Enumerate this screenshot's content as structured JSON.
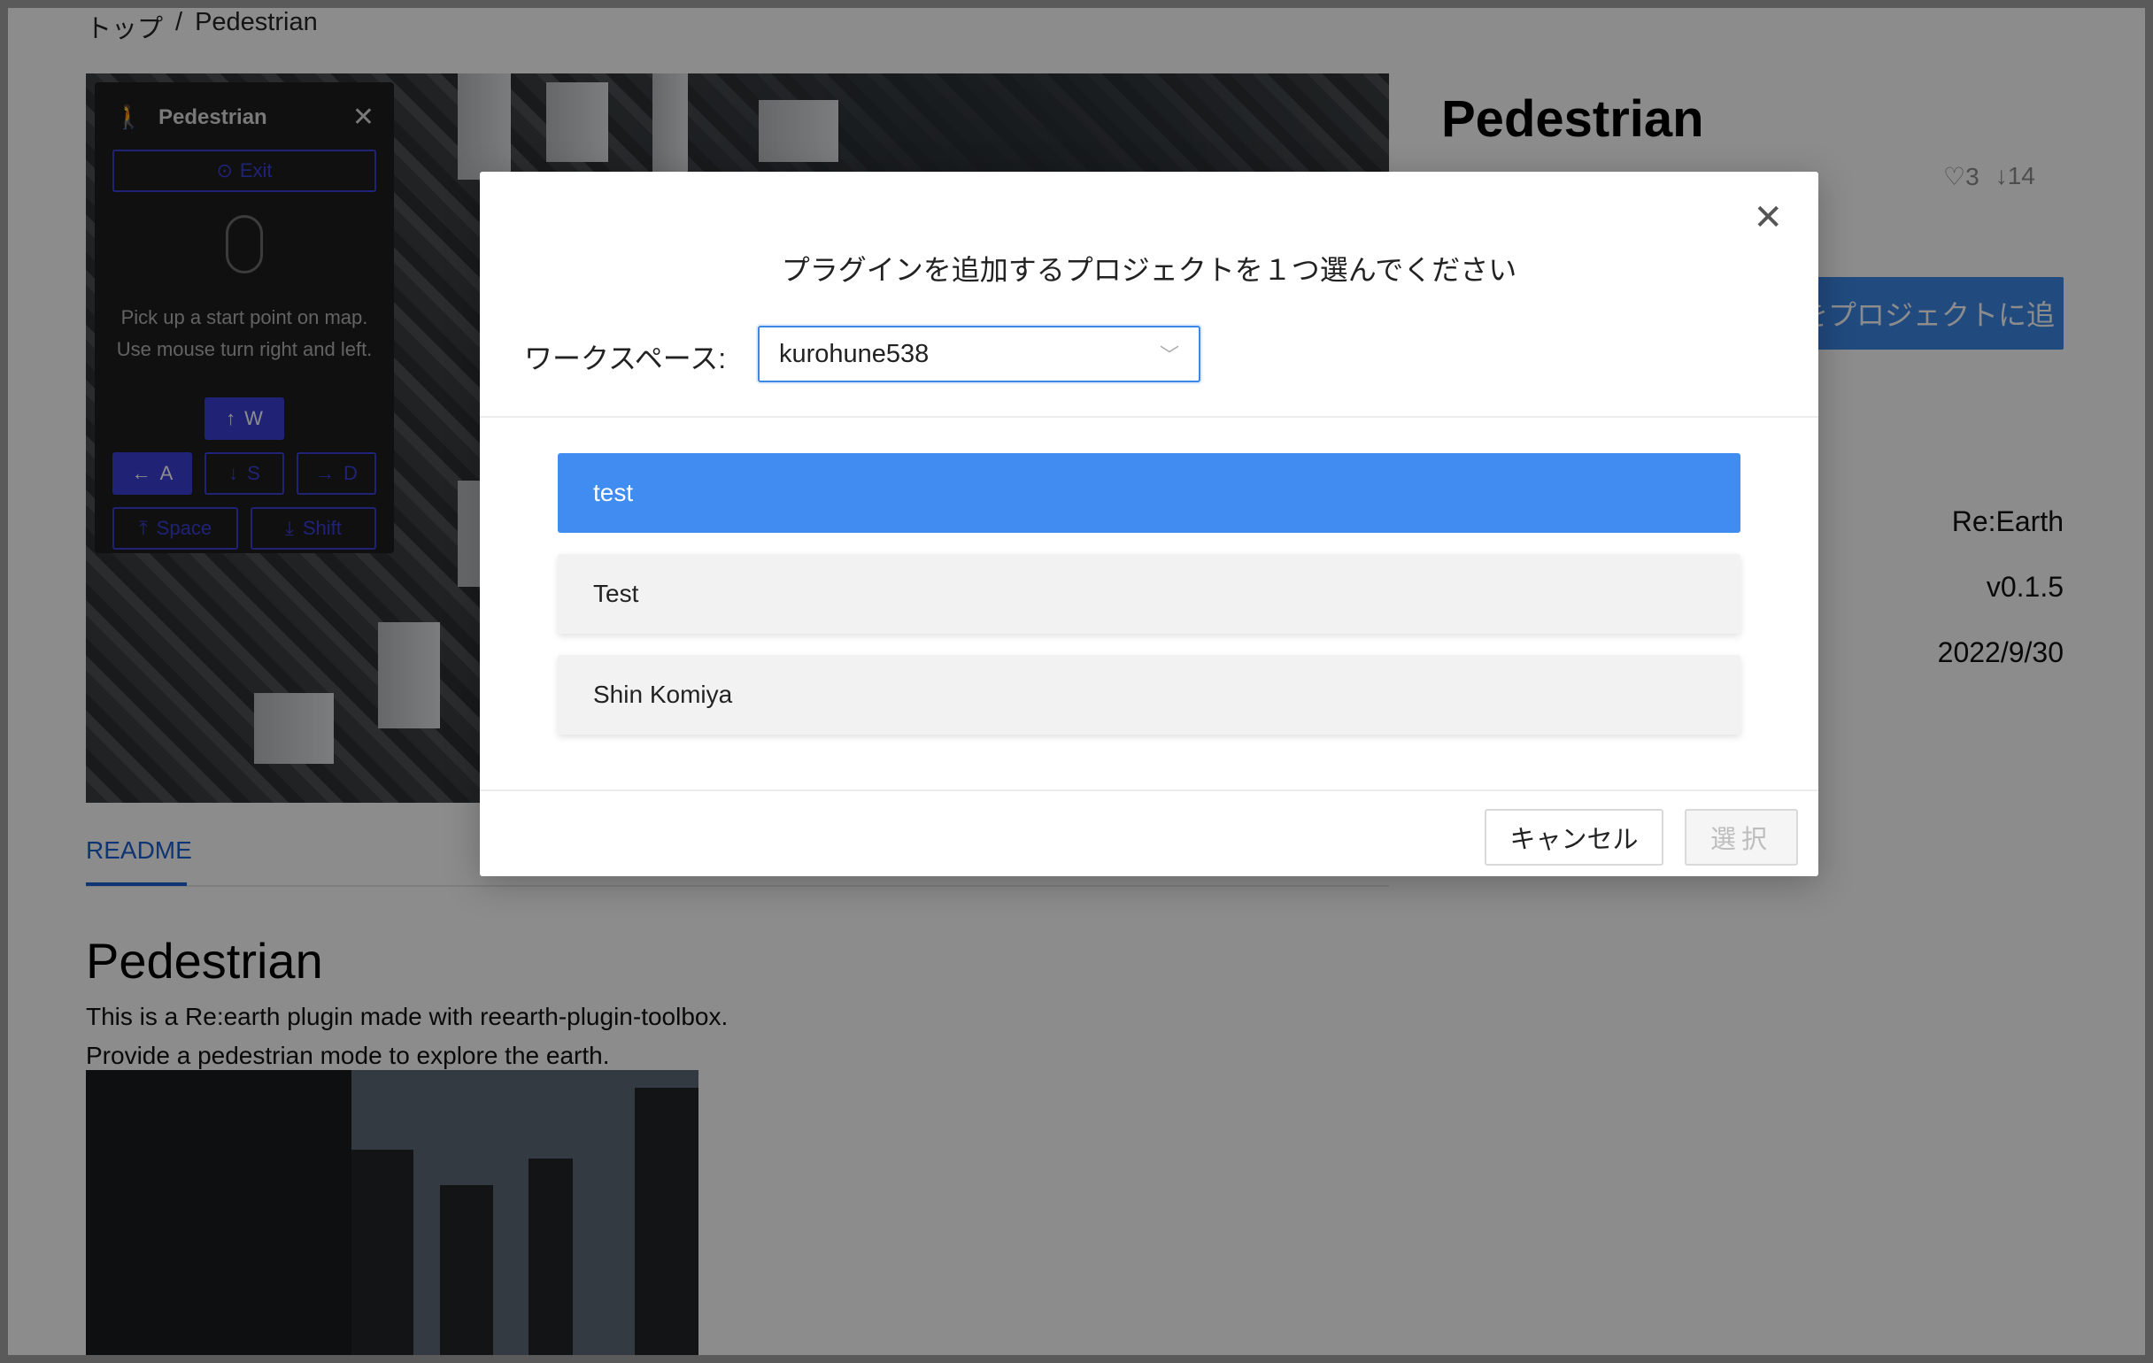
{
  "breadcrumb": [
    "トップ",
    "/",
    "Pedestrian"
  ],
  "plugin_panel": {
    "title": "Pedestrian",
    "exit_label": "Exit",
    "instructions": [
      "Pick up a start point on map.",
      "Use mouse turn right and left."
    ],
    "keys": {
      "w": "W",
      "a": "A",
      "s": "S",
      "d": "D",
      "space": "Space",
      "shift": "Shift"
    }
  },
  "plugin": {
    "title": "Pedestrian",
    "likes": "3",
    "downloads": "14",
    "add_button": "をプロジェクトに追",
    "author": "Re:Earth",
    "version": "v0.1.5",
    "date": "2022/9/30"
  },
  "tabs": [
    "README"
  ],
  "readme": {
    "heading": "Pedestrian",
    "lines": [
      "This is a Re:earth plugin made with reearth-plugin-toolbox.",
      "Provide a pedestrian mode to explore the earth."
    ]
  },
  "modal": {
    "title": "プラグインを追加するプロジェクトを１つ選んでください",
    "workspace_label": "ワークスペース:",
    "workspace_value": "kurohune538",
    "projects": [
      "test",
      "Test",
      "Shin Komiya"
    ],
    "selected_index": 0,
    "cancel_label": "キャンセル",
    "select_label": "選択"
  },
  "colors": {
    "accent": "#418cf0",
    "link": "#1a5fd1",
    "panel_accent": "#3b3fd8"
  }
}
